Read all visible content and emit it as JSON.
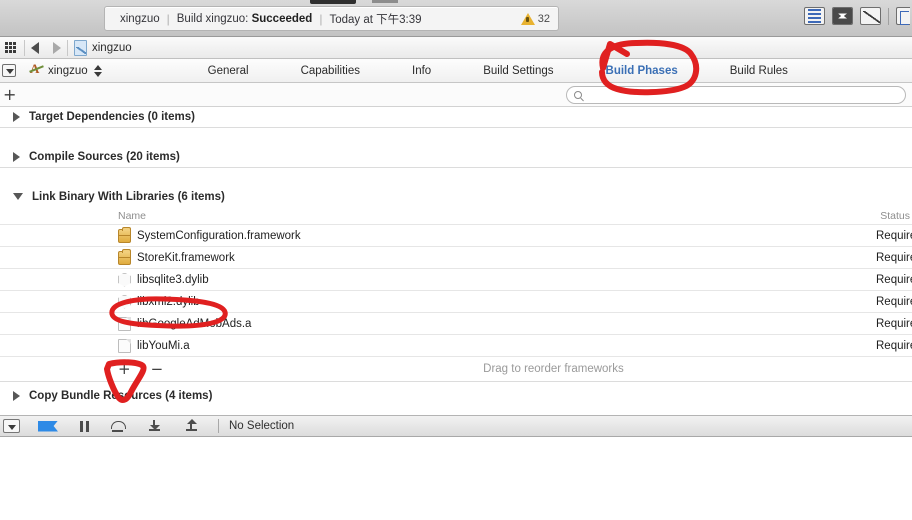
{
  "window": {
    "app": "Xcode",
    "status_bar": {
      "project": "xingzuo",
      "separator": "|",
      "action_prefix": "Build xingzuo:",
      "action_result": "Succeeded",
      "time": "Today at 下午3:39",
      "warning_count": "32",
      "warning_icon": "warning-triangle-icon"
    },
    "toolbar_icons": [
      {
        "name": "standard-editor-icon",
        "glyph": "editor-lines"
      },
      {
        "name": "assistant-editor-icon",
        "glyph": "assistant"
      },
      {
        "name": "version-editor-icon",
        "glyph": "version"
      },
      {
        "name": "utilities-panel-icon",
        "glyph": "panel-right"
      }
    ]
  },
  "navbar": {
    "grid_icon": "related-items-icon",
    "back_icon": "back-arrow-icon",
    "forward_icon": "forward-arrow-icon",
    "breadcrumb": "xingzuo",
    "breadcrumb_icon": "project-file-icon"
  },
  "tabbar": {
    "toggle_icon": "project-navigator-toggle-icon",
    "target_icon": "target-app-icon",
    "target_name": "xingzuo",
    "stepper_icon": "up-down-stepper-icon",
    "tabs": [
      {
        "label": "General",
        "active": false
      },
      {
        "label": "Capabilities",
        "active": false
      },
      {
        "label": "Info",
        "active": false
      },
      {
        "label": "Build Settings",
        "active": false
      },
      {
        "label": "Build Phases",
        "active": true
      },
      {
        "label": "Build Rules",
        "active": false
      }
    ],
    "active_tab_color": "#3a6fb5"
  },
  "filterbar": {
    "add_phase_label": "+",
    "search_icon": "search-icon",
    "search_value": "",
    "search_placeholder": ""
  },
  "phases": [
    {
      "title": "Target Dependencies (0 items)",
      "expanded": false
    },
    {
      "title": "Compile Sources (20 items)",
      "expanded": false
    },
    {
      "title": "Link Binary With Libraries (6 items)",
      "expanded": true
    },
    {
      "title": "Copy Bundle Resources (4 items)",
      "expanded": false
    }
  ],
  "link_binary_table": {
    "columns": {
      "name": "Name",
      "status": "Status"
    },
    "rows": [
      {
        "name": "SystemConfiguration.framework",
        "icon": "framework-icon",
        "icon_type": "framework",
        "status": "Required"
      },
      {
        "name": "StoreKit.framework",
        "icon": "framework-icon",
        "icon_type": "framework",
        "status": "Required"
      },
      {
        "name": "libsqlite3.dylib",
        "icon": "dylib-icon",
        "icon_type": "dylib",
        "status": "Required"
      },
      {
        "name": "libxml2.dylib",
        "icon": "dylib-icon",
        "icon_type": "dylib",
        "status": "Required"
      },
      {
        "name": "libGoogleAdMobAds.a",
        "icon": "static-library-icon",
        "icon_type": "archive",
        "status": "Required"
      },
      {
        "name": "libYouMi.a",
        "icon": "static-library-icon",
        "icon_type": "archive",
        "status": "Required"
      }
    ],
    "footer": {
      "add_label": "+",
      "remove_label": "−",
      "hint": "Drag to reorder frameworks"
    }
  },
  "debugbar": {
    "dropdown_icon": "scheme-dropdown-icon",
    "breakpoint_icon": "breakpoint-flag-icon",
    "pause_icon": "pause-icon",
    "step_over_icon": "step-over-icon",
    "step_into_icon": "step-into-icon",
    "step_out_icon": "step-out-icon",
    "selection_label": "No Selection"
  },
  "annotations": {
    "color": "#e02020",
    "marks": [
      {
        "name": "annotation-build-phases-circle",
        "target": "Build Phases"
      },
      {
        "name": "annotation-libxml2-circle",
        "target": "libxml2.dylib"
      },
      {
        "name": "annotation-add-framework-circle",
        "target": "+"
      }
    ]
  }
}
